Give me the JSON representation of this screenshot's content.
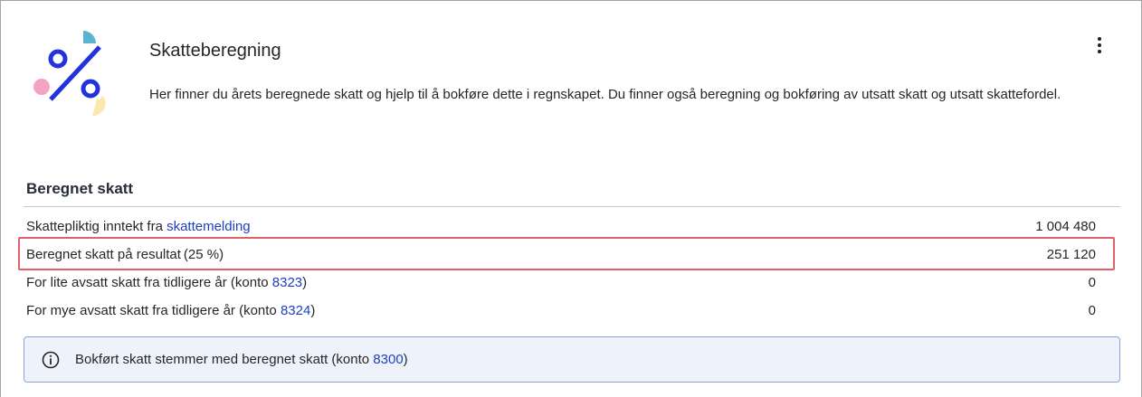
{
  "header": {
    "title": "Skatteberegning",
    "description": "Her finner du årets beregnede skatt og hjelp til å bokføre dette i regnskapet. Du finner også beregning og bokføring av utsatt skatt og utsatt skattefordel."
  },
  "section": {
    "heading": "Beregnet skatt",
    "rows": [
      {
        "label_prefix": "Skattepliktig inntekt fra ",
        "link": "skattemelding",
        "label_suffix": "",
        "value": "1 004 480"
      },
      {
        "label_prefix": "Beregnet skatt på resultat (25 %)",
        "link": "",
        "label_suffix": "",
        "value": "251 120"
      },
      {
        "label_prefix": "For lite avsatt skatt fra tidligere år (konto ",
        "link": "8323",
        "label_suffix": ")",
        "value": "0"
      },
      {
        "label_prefix": "For mye avsatt skatt fra tidligere år (konto ",
        "link": "8324",
        "label_suffix": ")",
        "value": "0"
      }
    ]
  },
  "alert": {
    "text_prefix": "Bokført skatt stemmer med beregnet skatt (konto ",
    "link": "8300",
    "text_suffix": ")"
  },
  "colors": {
    "link": "#1d3fbf",
    "highlight_border": "#e0606a",
    "alert_bg": "#eef2fb",
    "alert_border": "#8da2d4",
    "illustration_blue": "#2233dd",
    "illustration_pink": "#f4a3c4",
    "illustration_teal": "#5ab4cf",
    "illustration_yellow": "#fde7b0"
  },
  "icons": {
    "hero": "percent-illustration-icon",
    "menu": "more-vertical-icon",
    "alert": "info-icon"
  }
}
